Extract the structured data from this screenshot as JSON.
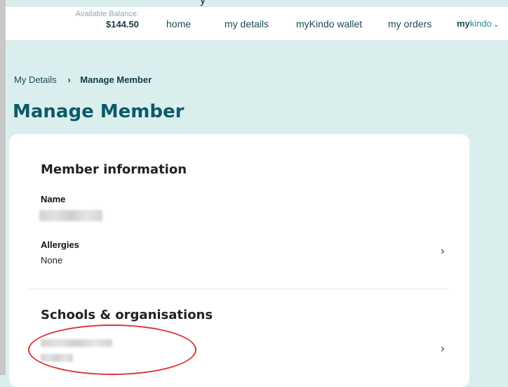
{
  "header": {
    "balance_label": "Available Balance:",
    "balance_amount": "$144.50",
    "nav": {
      "home": "home",
      "my_details": "my details",
      "wallet": "myKindo wallet",
      "orders": "my orders",
      "mykindo_bold": "my",
      "mykindo_rest": "kindo"
    },
    "chevron": "⌄"
  },
  "top_fragment": "y",
  "breadcrumb": {
    "parent": "My Details",
    "separator": "›",
    "current": "Manage Member"
  },
  "page_title": "Manage Member",
  "member_info": {
    "title": "Member information",
    "name_label": "Name",
    "allergies_label": "Allergies",
    "allergies_value": "None"
  },
  "schools": {
    "title": "Schools & organisations"
  },
  "icons": {
    "arrow": "›"
  },
  "colors": {
    "page_background": "#dbeeee",
    "title": "#0b5b68",
    "brand_teal": "#1f8f8c",
    "annotation_red": "#dd3333"
  }
}
